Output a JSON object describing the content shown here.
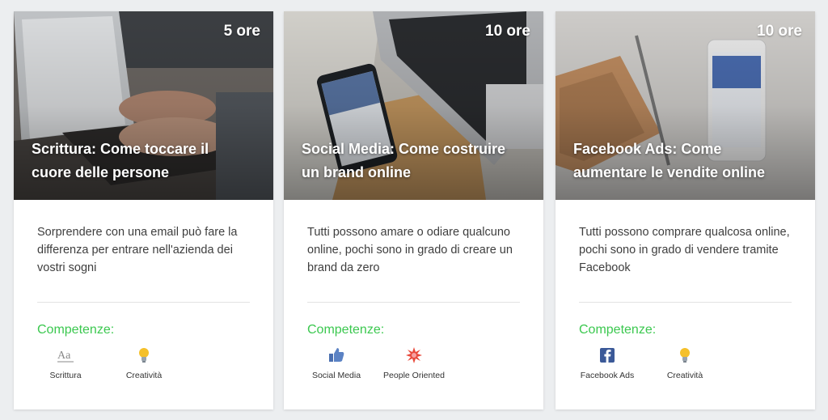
{
  "skills_heading": "Competenze:",
  "accent_color": "#3bc84f",
  "cards": [
    {
      "duration": "5 ore",
      "title": "Scrittura: Come toccare il cuore delle persone",
      "description": "Sorprendere con una email può fare la differenza per entrare nell'azienda dei vostri sogni",
      "skills": [
        {
          "label": "Scrittura",
          "icon": "text-style-icon"
        },
        {
          "label": "Creatività",
          "icon": "lightbulb-icon"
        }
      ]
    },
    {
      "duration": "10 ore",
      "title": "Social Media: Come costruire un brand online",
      "description": "Tutti possono amare o odiare qualcuno online, pochi sono in grado di creare un brand da zero",
      "skills": [
        {
          "label": "Social Media",
          "icon": "thumbs-up-icon"
        },
        {
          "label": "People Oriented",
          "icon": "starburst-icon"
        }
      ]
    },
    {
      "duration": "10 ore",
      "title": "Facebook Ads: Come aumentare le vendite online",
      "description": "Tutti possono comprare qualcosa online, pochi sono in grado di vendere tramite Facebook",
      "skills": [
        {
          "label": "Facebook Ads",
          "icon": "facebook-icon"
        },
        {
          "label": "Creatività",
          "icon": "lightbulb-icon"
        }
      ]
    }
  ]
}
